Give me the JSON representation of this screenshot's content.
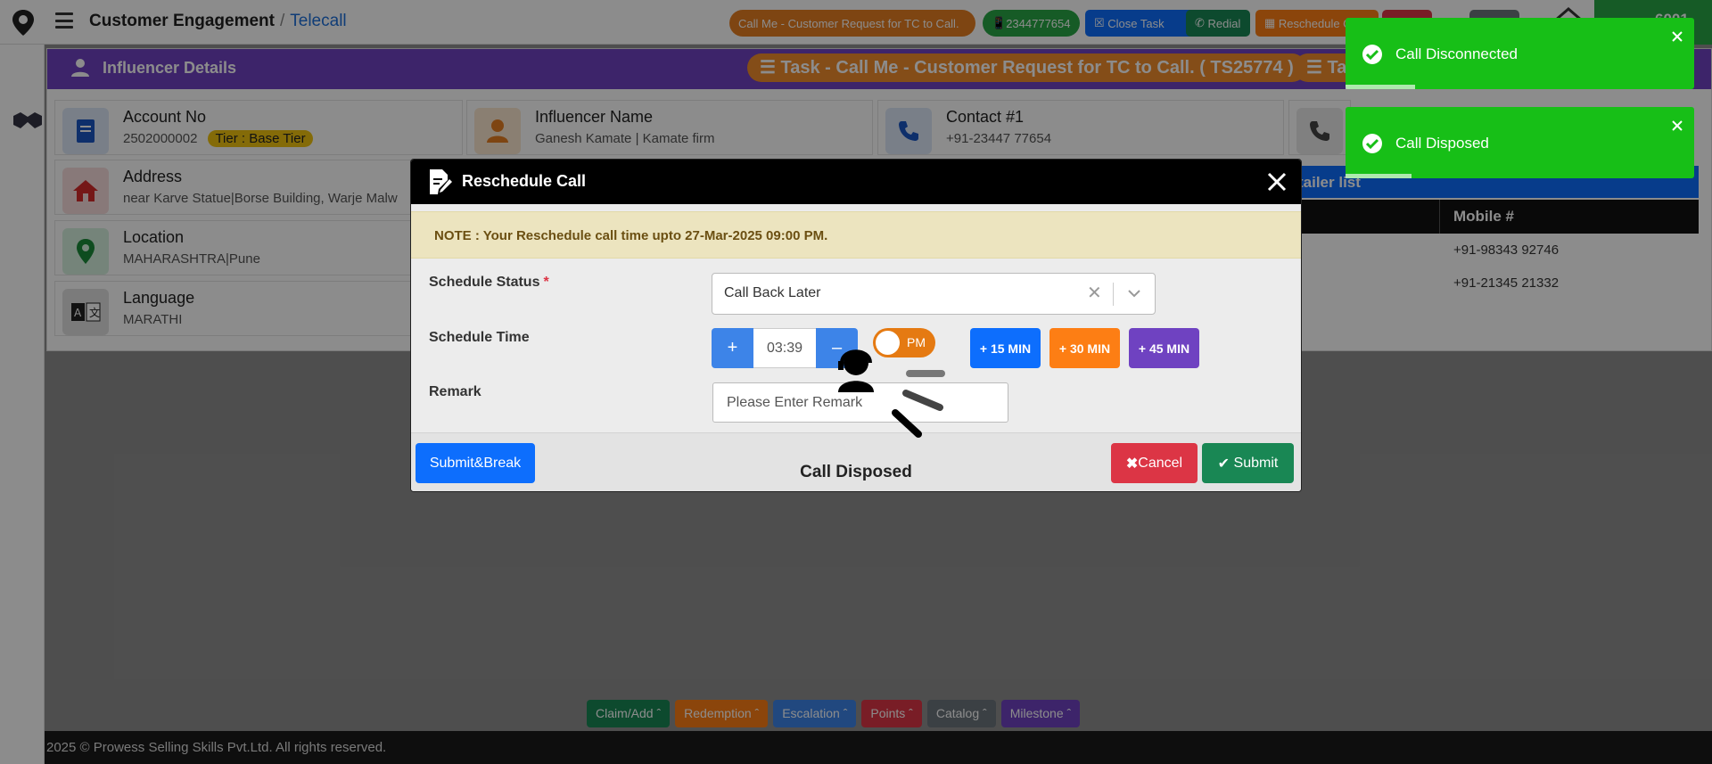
{
  "header": {
    "title": "Customer Engagement",
    "separator": "/",
    "subtitle": "Telecall",
    "task_chip": "Call Me - Customer Request for TC to Call.",
    "phone_chip": "2344777654",
    "close_task": "Close Task",
    "redial": "Redial",
    "reschedule": "Reschedule Call",
    "user_id": "6001"
  },
  "panel": {
    "title": "Influencer Details",
    "task_pill": "Task - Call Me - Customer Request for TC to Call. ( TS25774 )",
    "task_pill_2": "Ta",
    "cards": {
      "account_label": "Account No",
      "account_value": "2502000002",
      "tier": "Tier : Base Tier",
      "influencer_label": "Influencer Name",
      "influencer_value": "Ganesh Kamate | Kamate firm",
      "contact_label": "Contact #1",
      "contact_value": "+91-23447 77654",
      "address_label": "Address",
      "address_value": "near Karve Statue|Borse Building, Warje Malw",
      "location_label": "Location",
      "location_value": "MAHARASHTRA|Pune",
      "language_label": "Language",
      "language_value": "MARATHI"
    },
    "retailer_list": "tailer list",
    "mobile_header": "Mobile #",
    "mobiles": [
      "+91-98343 92746",
      "+91-21345 21332"
    ]
  },
  "modal": {
    "title": "Reschedule Call",
    "note": "NOTE : Your Reschedule call time upto 27-Mar-2025 09:00 PM.",
    "schedule_status_label": "Schedule Status",
    "required_mark": "*",
    "schedule_status_value": "Call Back Later",
    "schedule_time_label": "Schedule Time",
    "time_value": "03:39",
    "ampm": "PM",
    "plus_label": "+",
    "minus_label": "–",
    "q15": "+ 15 MIN",
    "q30": "+ 30 MIN",
    "q45": "+ 45 MIN",
    "remark_label": "Remark",
    "remark_placeholder": "Please Enter Remark",
    "submit_break": "Submit&Break",
    "cancel": "Cancel",
    "submit": "Submit",
    "status_text": "Call Disposed"
  },
  "toasts": [
    {
      "text": "Call Disconnected",
      "progress": 0.2
    },
    {
      "text": "Call Disposed",
      "progress": 0.19
    }
  ],
  "bottom_buttons": [
    {
      "label": "Claim/Add",
      "color": "#198754"
    },
    {
      "label": "Redemption",
      "color": "#fd7e14"
    },
    {
      "label": "Escalation",
      "color": "#3d84e8"
    },
    {
      "label": "Points",
      "color": "#dc3545"
    },
    {
      "label": "Catalog",
      "color": "#6c757d"
    },
    {
      "label": "Milestone",
      "color": "#6f42c1"
    }
  ],
  "footer": "2025 © Prowess Selling Skills Pvt.Ltd. All rights reserved.",
  "icons": [
    "logo-pin-icon",
    "hamburger-icon",
    "handshake-icon",
    "person-icon",
    "list-icon",
    "book-icon",
    "user-icon",
    "phone-icon",
    "home-icon",
    "map-pin-icon",
    "language-icon",
    "edit-doc-icon",
    "close-icon",
    "chevron-down-icon",
    "check-circle-icon",
    "headset-agent-icon"
  ]
}
